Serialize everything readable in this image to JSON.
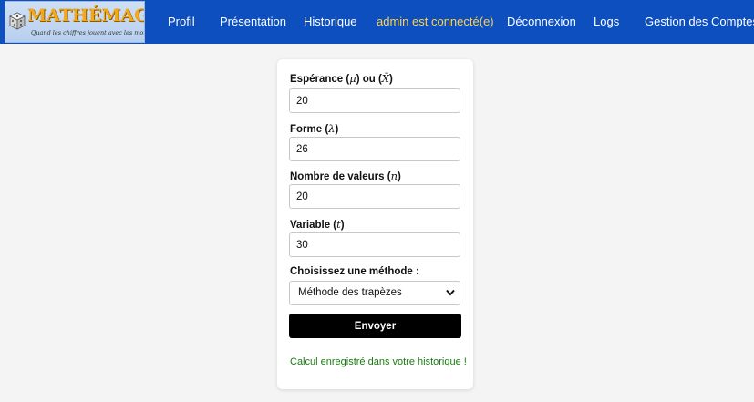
{
  "brand": {
    "logo_text": "MATHÉMAGIE",
    "tagline": "Quand les chiffres jouent avec les mots"
  },
  "nav": {
    "items": [
      {
        "id": "profil",
        "label": "Profil"
      },
      {
        "id": "presentation",
        "label": "Présentation"
      },
      {
        "id": "historique",
        "label": "Historique"
      },
      {
        "id": "status",
        "label": "admin est connecté(e)"
      },
      {
        "id": "deconnexion",
        "label": "Déconnexion"
      },
      {
        "id": "logs",
        "label": "Logs"
      },
      {
        "id": "gestion",
        "label": "Gestion des Comptes"
      }
    ]
  },
  "form": {
    "esperance": {
      "label_prefix": "Espérance (",
      "symbol_mu": "μ",
      "label_mid": ") ou (",
      "symbol_xbar": "X̄",
      "label_suffix": ")",
      "value": "20"
    },
    "forme": {
      "label_prefix": "Forme (",
      "symbol": "λ",
      "label_suffix": ")",
      "value": "26"
    },
    "nombre": {
      "label_prefix": "Nombre de valeurs (",
      "symbol": "n",
      "label_suffix": ")",
      "value": "20"
    },
    "variable": {
      "label_prefix": "Variable (",
      "symbol": "t",
      "label_suffix": ")",
      "value": "30"
    },
    "methode": {
      "label": "Choisissez une méthode :",
      "selected": "Méthode des trapèzes"
    },
    "submit_label": "Envoyer",
    "success_message": "Calcul enregistré dans votre historique !"
  },
  "colors": {
    "navbar": "#0d4fbf",
    "status_text": "#ffd24a",
    "success_text": "#1a7a12",
    "button": "#000000"
  }
}
